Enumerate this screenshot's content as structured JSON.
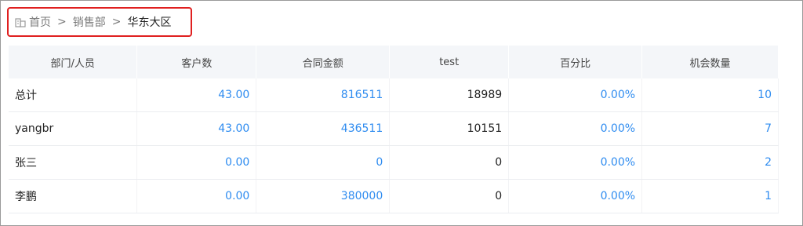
{
  "breadcrumb": {
    "items": [
      "首页",
      "销售部",
      "华东大区"
    ],
    "separator": ">"
  },
  "table": {
    "headers": [
      "部门/人员",
      "客户数",
      "合同金额",
      "test",
      "百分比",
      "机会数量"
    ],
    "rows": [
      {
        "name": "总计",
        "customers": "43.00",
        "amount": "816511",
        "test": "18989",
        "percent": "0.00%",
        "opportunities": "10"
      },
      {
        "name": "yangbr",
        "customers": "43.00",
        "amount": "436511",
        "test": "10151",
        "percent": "0.00%",
        "opportunities": "7"
      },
      {
        "name": "张三",
        "customers": "0.00",
        "amount": "0",
        "test": "0",
        "percent": "0.00%",
        "opportunities": "2"
      },
      {
        "name": "李鹏",
        "customers": "0.00",
        "amount": "380000",
        "test": "0",
        "percent": "0.00%",
        "opportunities": "1"
      }
    ]
  },
  "colors": {
    "link": "#2f8cf0",
    "highlight_border": "#e02020",
    "header_bg": "#f4f6f9"
  }
}
